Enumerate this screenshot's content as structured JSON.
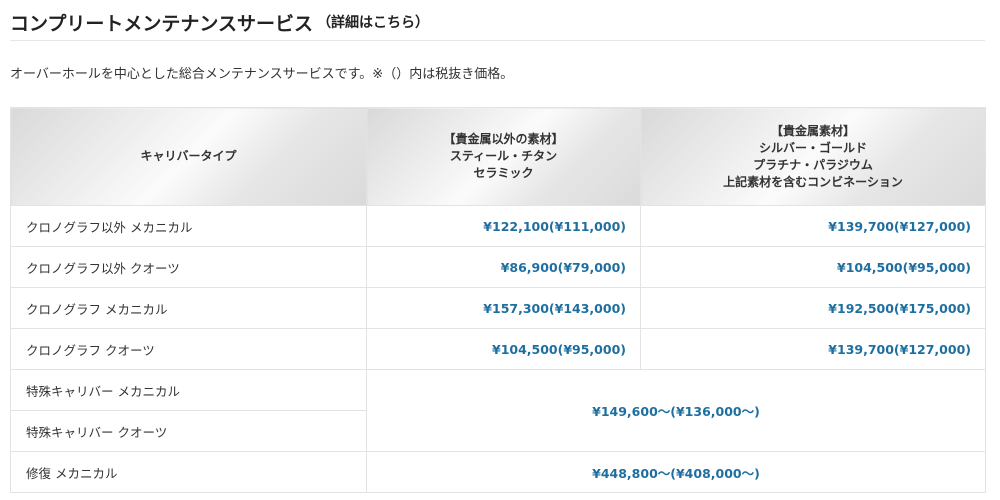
{
  "header": {
    "title": "コンプリートメンテナンスサービス",
    "details_link": "（詳細はこちら）"
  },
  "description": "オーバーホールを中心とした総合メンテナンスサービスです。※（）内は税抜き価格。",
  "table": {
    "columns": {
      "caliber_type": "キャリバータイプ",
      "non_precious": [
        "【貴金属以外の素材】",
        "スティール・チタン",
        "セラミック"
      ],
      "precious": [
        "【貴金属素材】",
        "シルバー・ゴールド",
        "プラチナ・パラジウム",
        "上記素材を含むコンビネーション"
      ]
    },
    "rows": [
      {
        "label": "クロノグラフ以外 メカニカル",
        "non_precious": "¥122,100(¥111,000)",
        "precious": "¥139,700(¥127,000)"
      },
      {
        "label": "クロノグラフ以外 クオーツ",
        "non_precious": "¥86,900(¥79,000)",
        "precious": "¥104,500(¥95,000)"
      },
      {
        "label": "クロノグラフ メカニカル",
        "non_precious": "¥157,300(¥143,000)",
        "precious": "¥192,500(¥175,000)"
      },
      {
        "label": "クロノグラフ クオーツ",
        "non_precious": "¥104,500(¥95,000)",
        "precious": "¥139,700(¥127,000)"
      }
    ],
    "special": {
      "label_mechanical": "特殊キャリバー メカニカル",
      "label_quartz": "特殊キャリバー クオーツ",
      "price": "¥149,600～(¥136,000～)"
    },
    "restoration": {
      "label": "修復 メカニカル",
      "price": "¥448,800～(¥408,000～)"
    }
  },
  "colors": {
    "price_text": "#1e6f9f",
    "border": "#e3e3e3"
  }
}
